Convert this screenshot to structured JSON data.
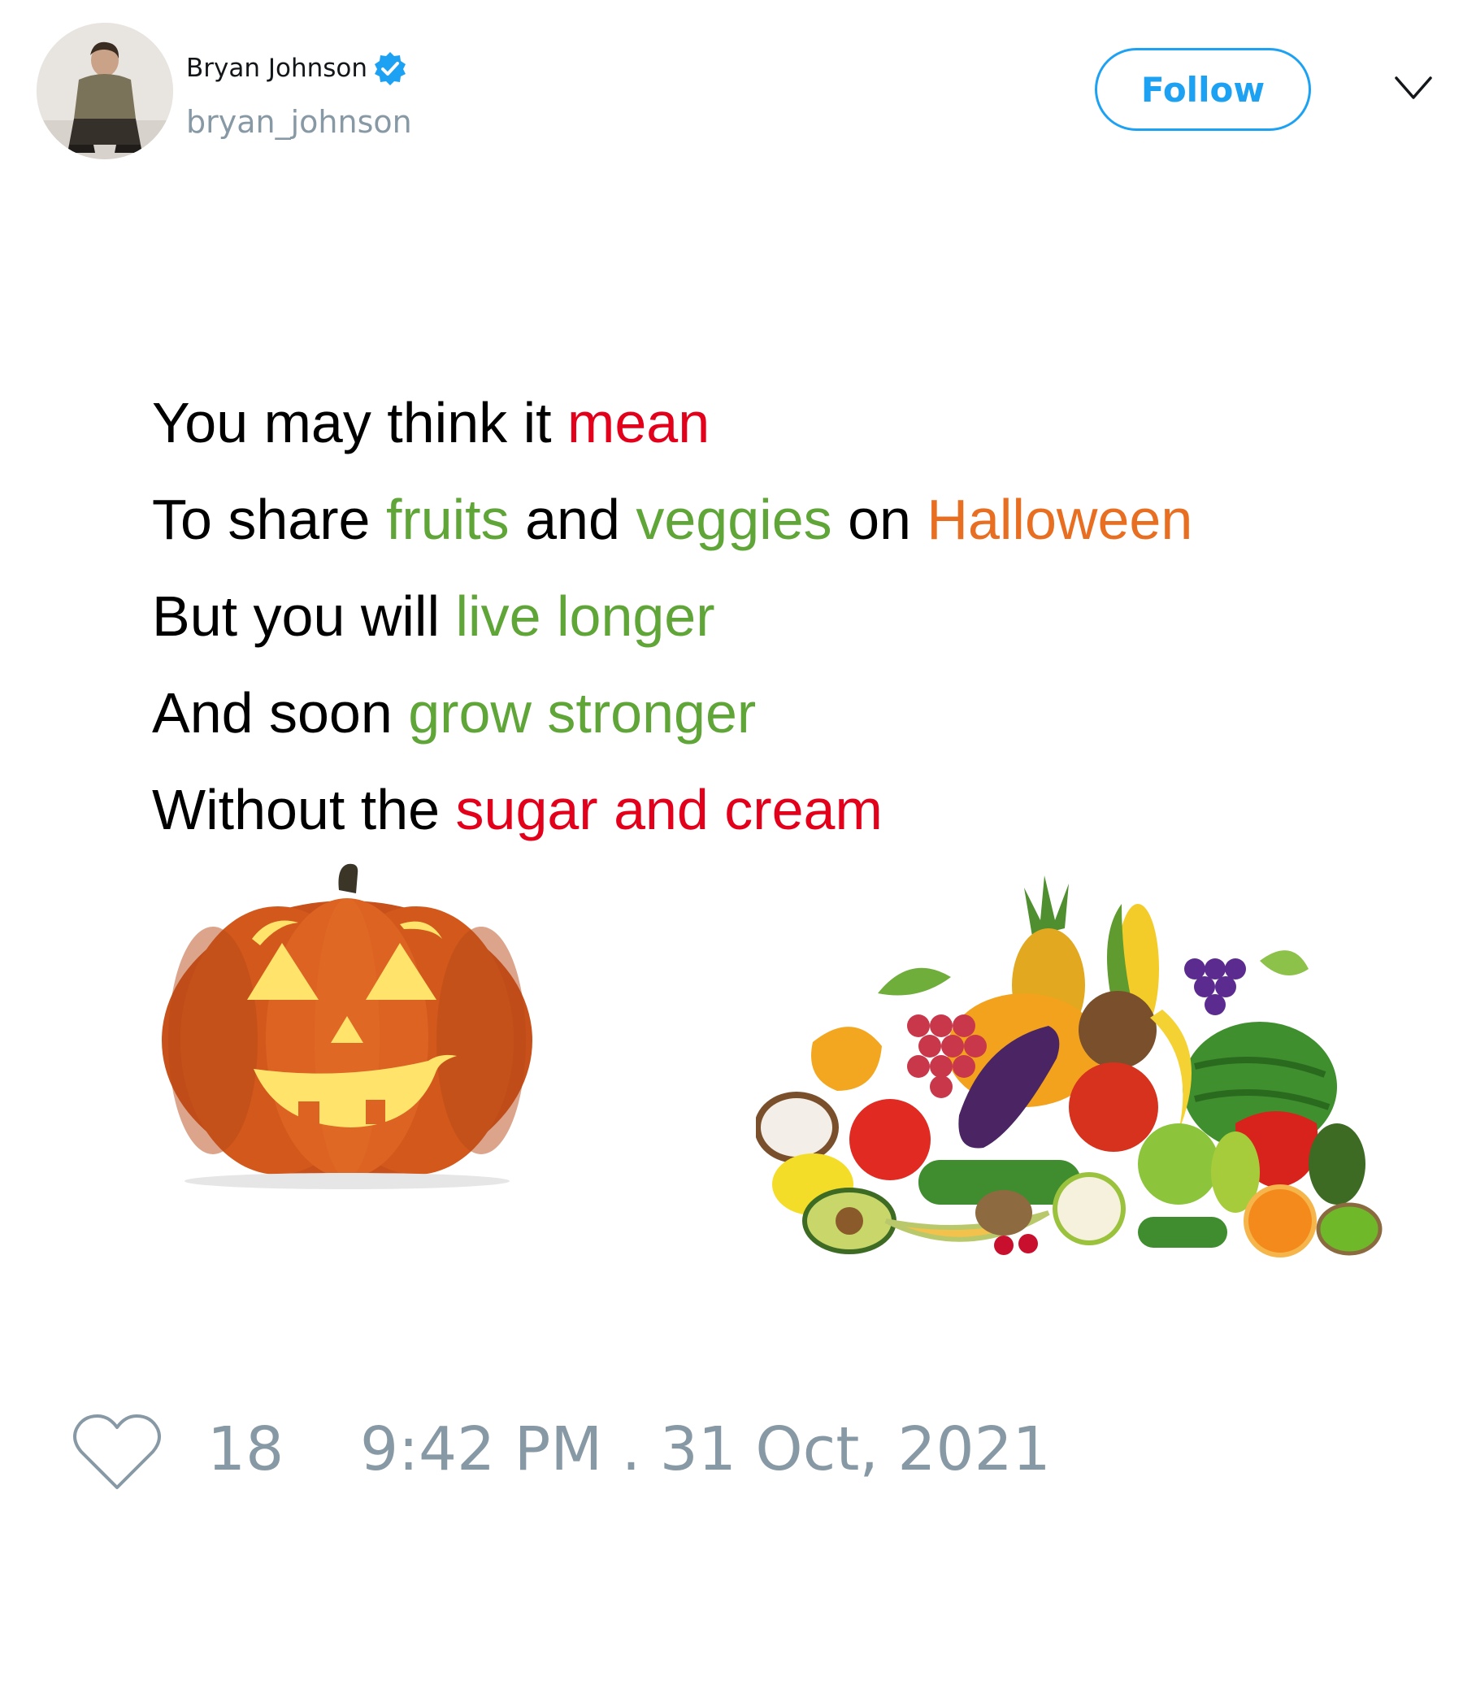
{
  "tweet": {
    "author": {
      "name": "Bryan Johnson",
      "handle": "bryan_johnson",
      "verified_icon": "verified-badge",
      "avatar_icon": "avatar-photo"
    },
    "follow_label": "Follow",
    "menu_icon": "chevron-down",
    "poem": {
      "lines": [
        [
          {
            "text": "You may think it ",
            "color": "#000000"
          },
          {
            "text": "mean",
            "color": "#e3001b"
          }
        ],
        [
          {
            "text": "To share ",
            "color": "#000000"
          },
          {
            "text": "fruits",
            "color": "#5fa538"
          },
          {
            "text": " and ",
            "color": "#000000"
          },
          {
            "text": "veggies",
            "color": "#5fa538"
          },
          {
            "text": " on ",
            "color": "#000000"
          },
          {
            "text": "Halloween",
            "color": "#e86f22"
          }
        ],
        [
          {
            "text": "But you will ",
            "color": "#000000"
          },
          {
            "text": "live longer",
            "color": "#5fa538"
          }
        ],
        [
          {
            "text": "And soon ",
            "color": "#000000"
          },
          {
            "text": "grow stronger",
            "color": "#5fa538"
          }
        ],
        [
          {
            "text": "Without the ",
            "color": "#000000"
          },
          {
            "text": "sugar and cream",
            "color": "#e3001b"
          }
        ]
      ]
    },
    "images": [
      "jack-o-lantern",
      "fruit-and-vegetable-pile"
    ],
    "likes": "18",
    "like_icon": "heart-outline",
    "timestamp": "9:42 PM . 31 Oct, 2021",
    "colors": {
      "accent": "#1da1f2",
      "muted": "#8899a6",
      "text": "#14171a"
    }
  }
}
